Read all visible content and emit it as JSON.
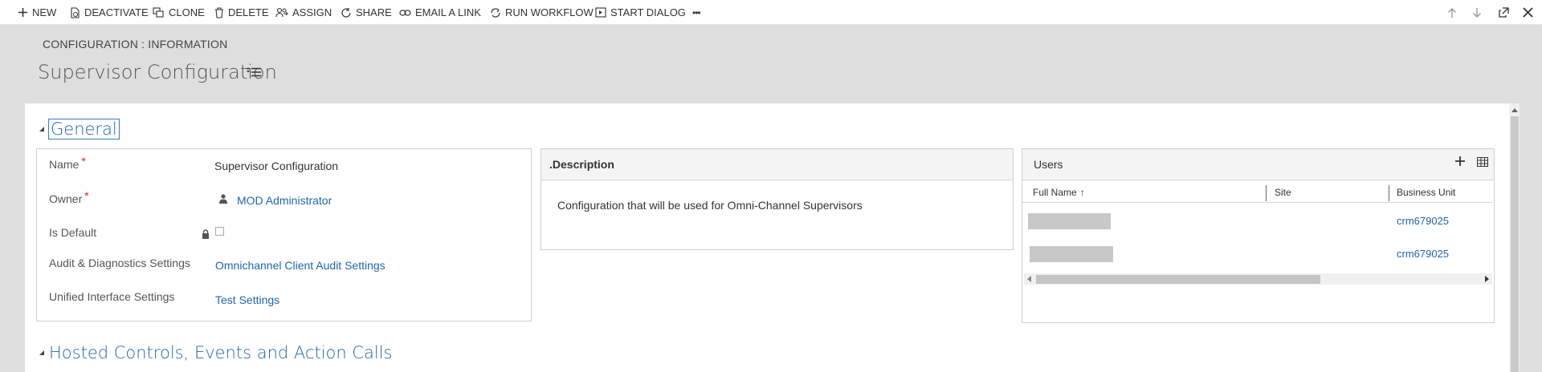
{
  "toolbar": {
    "new": "NEW",
    "deactivate": "DEACTIVATE",
    "clone": "CLONE",
    "delete": "DELETE",
    "assign": "ASSIGN",
    "share": "SHARE",
    "email_link": "EMAIL A LINK",
    "run_workflow": "RUN WORKFLOW",
    "start_dialog": "START DIALOG",
    "more": "•••"
  },
  "header": {
    "breadcrumb": "CONFIGURATION : INFORMATION",
    "title": "Supervisor Configuration"
  },
  "general": {
    "section_title": "General",
    "fields": {
      "name_label": "Name",
      "name_value": "Supervisor Configuration",
      "owner_label": "Owner",
      "owner_value": "MOD Administrator",
      "is_default_label": "Is Default",
      "audit_label": "Audit & Diagnostics Settings",
      "audit_value": "Omnichannel Client Audit Settings",
      "ui_label": "Unified Interface Settings",
      "ui_value": "Test Settings"
    },
    "required_mark": "*",
    "description": {
      "title": ".Description",
      "text": "Configuration that will be used for Omni-Channel Supervisors"
    },
    "users": {
      "title": "Users",
      "columns": [
        "Full Name",
        "Site",
        "Business Unit"
      ],
      "sort_arrow": "↑",
      "rows": [
        {
          "business_unit": "crm679025"
        },
        {
          "business_unit": "crm679025"
        }
      ]
    }
  },
  "hosted_section_title": "Hosted Controls, Events and Action Calls",
  "colors": {
    "link": "#2266a8",
    "required": "#d02020",
    "header_bg": "#dedede"
  }
}
